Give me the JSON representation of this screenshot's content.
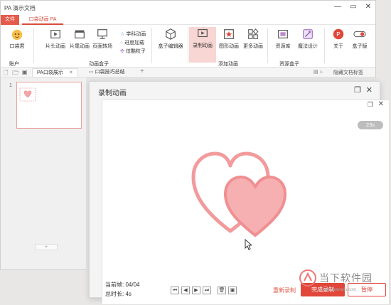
{
  "app": {
    "title": "PA 演示文档",
    "tabs": {
      "file": "文件",
      "active": "口袋动画 PA"
    }
  },
  "ribbon": {
    "account": {
      "label": "口袋君",
      "group": "账户"
    },
    "buttons": {
      "intro": "片头动画",
      "outro": "片尾动画",
      "transition": "页面转场",
      "box_editor": "盒子编辑器",
      "record": "录制动画",
      "graphic": "图形动画",
      "more": "更多动画",
      "resources": "资源库",
      "magic": "魔法设计",
      "about": "关于",
      "box_ver": "盒子版"
    },
    "small_items": {
      "subject": "学科动画",
      "progress": "进度加载",
      "particles": "炫酷粒子"
    },
    "groups": {
      "anim_box": "动画盒子",
      "add_anim": "添加动画",
      "resource_box": "资源盒子"
    }
  },
  "doc_tabs": {
    "tab1": "PA口袋展示",
    "tab2": "口袋技巧总结",
    "hide_tabs": "隐藏文档标签"
  },
  "slides": {
    "first_num": "1",
    "add_symbol": "+"
  },
  "dialog": {
    "title": "录制动画",
    "time_badge": "23s",
    "current_frame_label": "当前帧: 04/04",
    "total_time_label": "总时长: 4s",
    "rerecord": "重新录制",
    "done": "完成录制",
    "pause": "暂停"
  },
  "watermark": {
    "text": "当下软件园",
    "sub": "www.downxia.com"
  },
  "colors": {
    "accent": "#e0463a",
    "heart": "#f08f91",
    "active_tab_bg": "#f8d6d3"
  }
}
